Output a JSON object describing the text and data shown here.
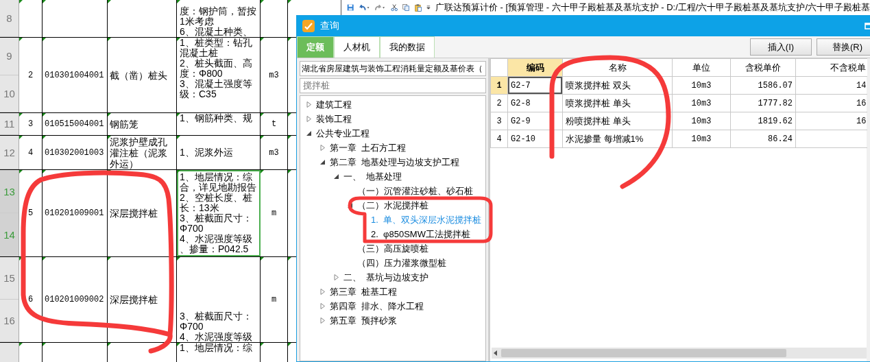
{
  "spreadsheet": {
    "rows": [
      {
        "row_numbers": [
          "8"
        ],
        "selected": false,
        "seq": "",
        "code": "",
        "name": "",
        "description": [
          "度：钢护筒，暂按1米考虑",
          "6、混凝土种类、"
        ],
        "unit": ""
      },
      {
        "row_numbers": [
          "9",
          "10"
        ],
        "selected": false,
        "seq": "2",
        "code": "010301004001",
        "name": "截（凿）桩头",
        "description": [
          "1、桩类型：钻孔混凝土桩",
          "2、桩头截面、高度：Φ800",
          "3、混凝土强度等级：C35"
        ],
        "unit": "m3"
      },
      {
        "row_numbers": [
          "11"
        ],
        "selected": false,
        "seq": "3",
        "code": "010515004001",
        "name": "钢筋笼",
        "description": [
          "1、钢筋种类、规"
        ],
        "unit": "t"
      },
      {
        "row_numbers": [
          "12"
        ],
        "selected": false,
        "seq": "4",
        "code": "010302001003",
        "name": "泥浆护壁成孔灌注桩（泥浆外运）",
        "description": [
          "1、泥浆外运"
        ],
        "unit": "m3"
      },
      {
        "row_numbers": [
          "13",
          "14"
        ],
        "selected": true,
        "seq": "5",
        "code": "010201009001",
        "name": "深层搅拌桩",
        "description": [
          "1、地层情况：综合，详见地勘报告",
          "2、空桩长度、桩长：13米",
          "3、桩截面尺寸：Φ700",
          "4、水泥强度等级、掺量：P042.5"
        ],
        "unit": "m"
      },
      {
        "row_numbers": [
          "15",
          "16"
        ],
        "selected": false,
        "seq": "6",
        "code": "010201009002",
        "name": "深层搅拌桩",
        "description": [
          "3、桩截面尺寸：Φ700",
          "4、水泥强度等级"
        ],
        "unit": "m"
      },
      {
        "selected": false,
        "seq": "",
        "code": "",
        "name": "",
        "description": [
          "1、地层情况：综"
        ],
        "unit": ""
      }
    ]
  },
  "app_toolbar": {
    "title": "广联达预算计价 - [预算管理 - 六十甲子殿桩基及基坑支护 - D:/工程/六十甲子殿桩基及基坑支护/六十甲子殿桩基"
  },
  "dialog": {
    "title": "查询",
    "tabs": [
      {
        "label": "定额",
        "selected": true
      },
      {
        "label": "人材机",
        "selected": false
      },
      {
        "label": "我的数据",
        "selected": false
      }
    ],
    "buttons": [
      "插入(I)",
      "替换(R)"
    ],
    "library_dropdown": {
      "value": "湖北省房屋建筑与装饰工程消耗量定额及基价表（"
    },
    "search": {
      "value": "搅拌桩"
    },
    "tree": [
      {
        "label": "建筑工程",
        "expanded": false,
        "selected": false
      },
      {
        "label": "装饰工程",
        "expanded": false,
        "selected": false
      },
      {
        "label": "公共专业工程",
        "expanded": true,
        "selected": false,
        "children": [
          {
            "label": "第一章  土石方工程",
            "expanded": false,
            "selected": false
          },
          {
            "label": "第二章  地基处理与边坡支护工程",
            "expanded": true,
            "selected": false,
            "children": [
              {
                "label": "一、  地基处理",
                "expanded": true,
                "selected": false,
                "children": [
                  {
                    "label": "（一）沉管灌注砂桩、砂石桩",
                    "selected": false
                  },
                  {
                    "label": "（二）水泥搅拌桩",
                    "expanded": true,
                    "selected": false,
                    "children": [
                      {
                        "label": "1.  单、双头深层水泥搅拌桩",
                        "selected": true
                      },
                      {
                        "label": "2.  φ850SMW工法搅拌桩",
                        "selected": false
                      }
                    ]
                  },
                  {
                    "label": "（三）高压旋喷桩",
                    "selected": false
                  },
                  {
                    "label": "（四）压力灌浆微型桩",
                    "selected": false
                  }
                ]
              },
              {
                "label": "二、  基坑与边坡支护",
                "expanded": false,
                "selected": false
              }
            ]
          },
          {
            "label": "第三章  桩基工程",
            "expanded": false,
            "selected": false
          },
          {
            "label": "第四章  排水、降水工程",
            "expanded": false,
            "selected": false
          },
          {
            "label": "第五章  预拌砂浆",
            "expanded": false,
            "selected": false
          }
        ]
      }
    ],
    "table": {
      "columns": [
        {
          "label": "编码",
          "selected": true
        },
        {
          "label": "名称",
          "selected": false
        },
        {
          "label": "单位",
          "selected": false
        },
        {
          "label": "含税单价",
          "selected": false
        },
        {
          "label": "不含税单",
          "selected": false
        }
      ],
      "rows": [
        {
          "number": "1",
          "selected": true,
          "code": "G2-7",
          "name": "喷浆搅拌桩 双头",
          "unit": "10m3",
          "price_with_tax": "1586.07",
          "price_without_tax": "14"
        },
        {
          "number": "2",
          "selected": false,
          "code": "G2-8",
          "name": "喷浆搅拌桩 单头",
          "unit": "10m3",
          "price_with_tax": "1777.82",
          "price_without_tax": "16"
        },
        {
          "number": "3",
          "selected": false,
          "code": "G2-9",
          "name": "粉喷搅拌桩 单头",
          "unit": "10m3",
          "price_with_tax": "1819.62",
          "price_without_tax": "16"
        },
        {
          "number": "4",
          "selected": false,
          "code": "G2-10",
          "name": "水泥掺量 每增减1%",
          "unit": "10m3",
          "price_with_tax": "86.24",
          "price_without_tax": ""
        }
      ]
    }
  }
}
